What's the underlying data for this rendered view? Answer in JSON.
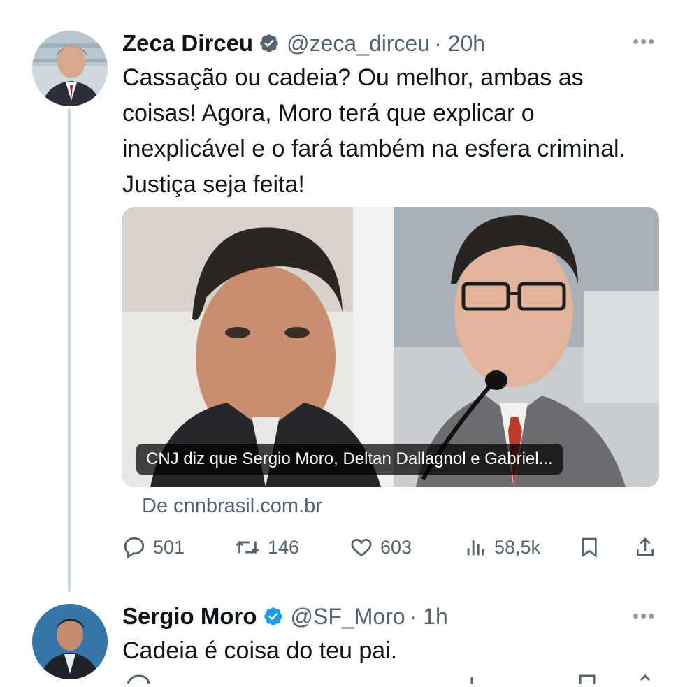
{
  "tweets": [
    {
      "display_name": "Zeca Dirceu",
      "handle": "@zeca_dirceu",
      "time": "· 20h",
      "text": "Cassação ou cadeia? Ou melhor, ambas as coisas! Agora, Moro terá que explicar o inexplicável e o fará também na esfera criminal. Justiça seja feita!",
      "media_caption": "CNJ diz que Sergio Moro, Deltan Dallagnol e Gabriel...",
      "source": "De cnnbrasil.com.br",
      "metrics": {
        "replies": "501",
        "retweets": "146",
        "likes": "603",
        "views": "58,5k"
      }
    },
    {
      "display_name": "Sergio Moro",
      "handle": "@SF_Moro",
      "time": "· 1h",
      "text": "Cadeia é coisa do teu pai."
    }
  ],
  "icons": {
    "verified": "verified-badge-icon",
    "more": "more-options-icon",
    "reply": "reply-icon",
    "retweet": "retweet-icon",
    "like": "heart-icon",
    "views": "views-chart-icon",
    "bookmark": "bookmark-icon",
    "share": "share-icon"
  },
  "colors": {
    "verified": "#1d9bf0",
    "text": "#0f1419",
    "secondary": "#536471",
    "thread_line": "#cfd9de"
  }
}
